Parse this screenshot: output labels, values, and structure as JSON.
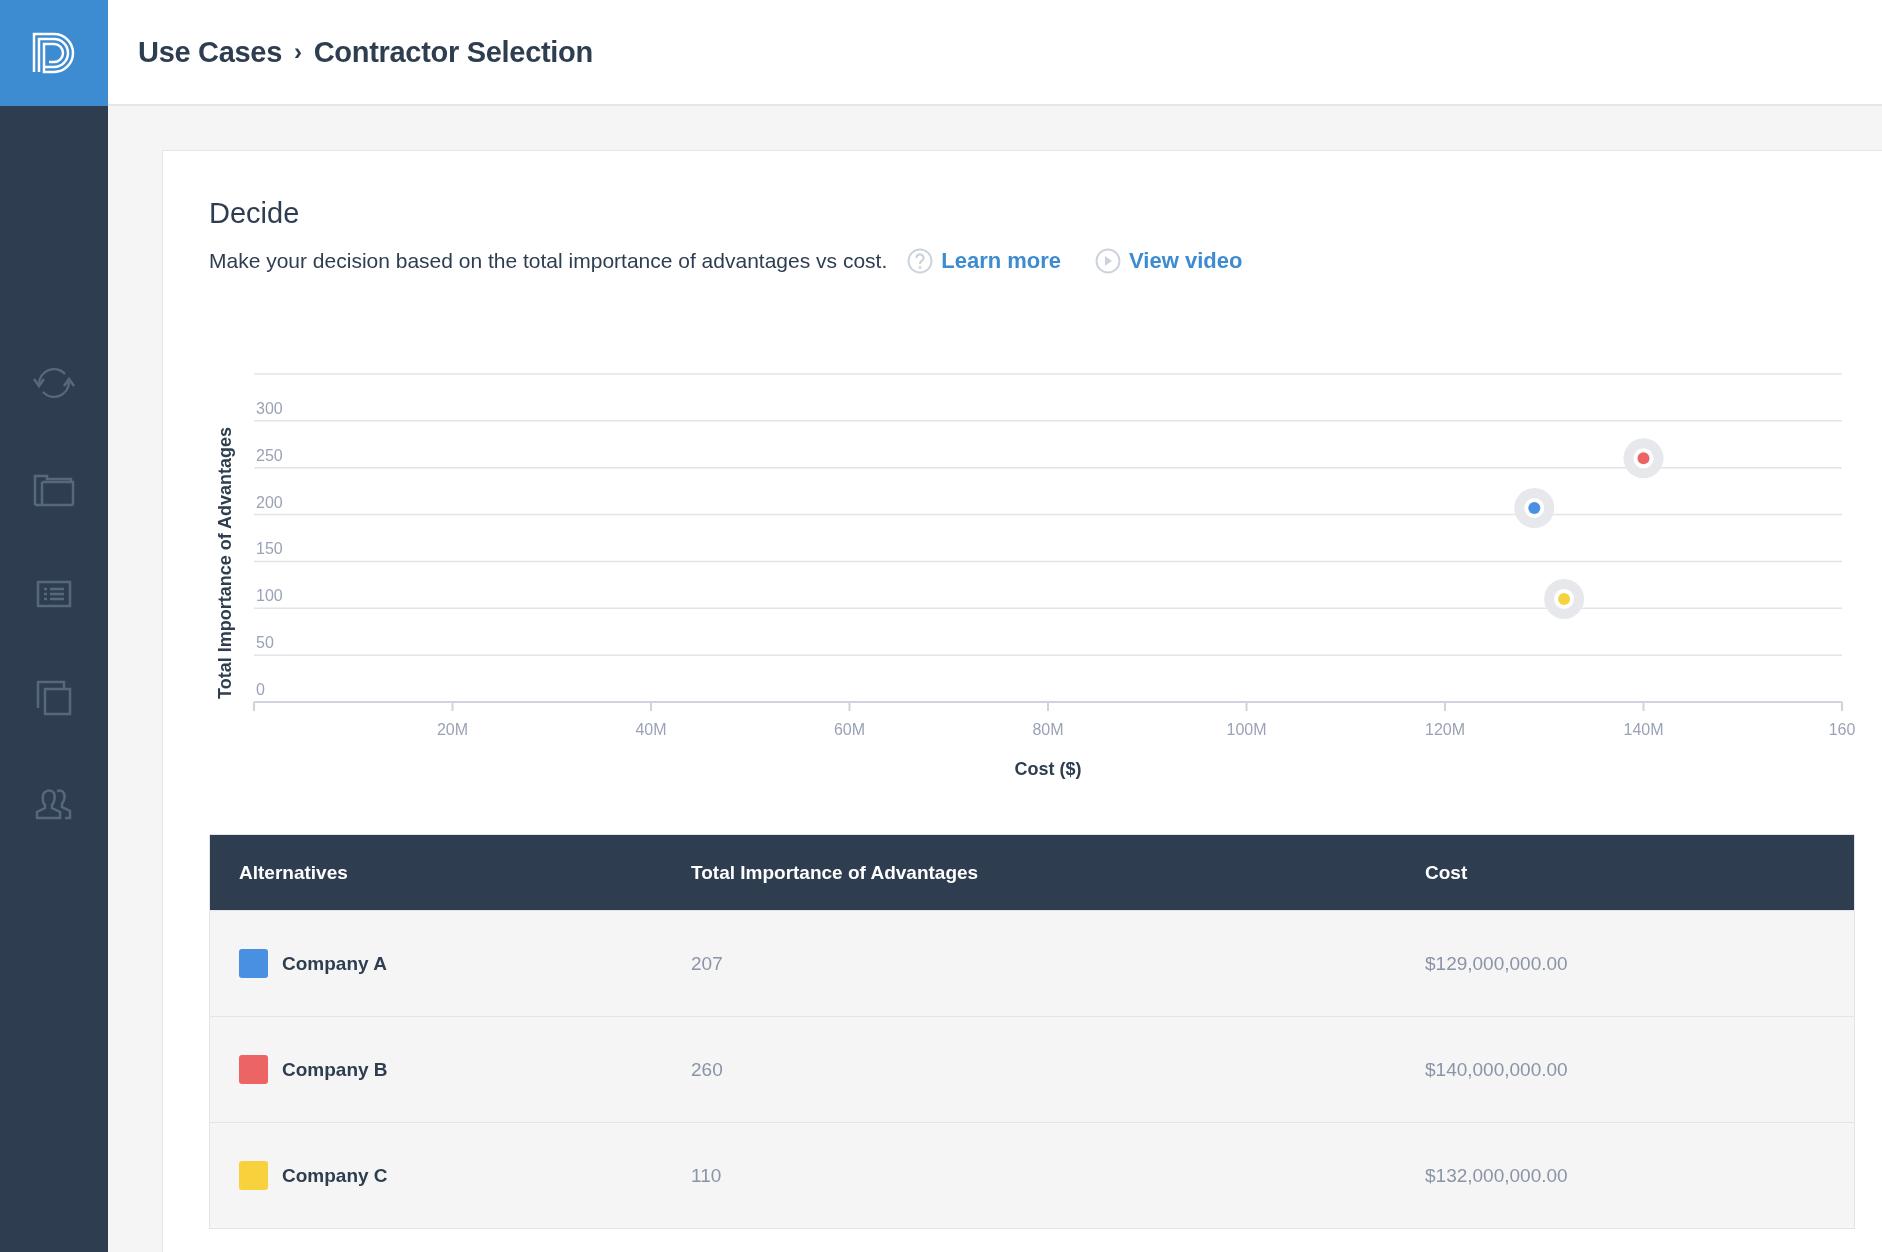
{
  "header": {
    "breadcrumb": [
      "Use Cases",
      "Contractor Selection"
    ],
    "separator": "›"
  },
  "section": {
    "title": "Decide",
    "description": "Make your decision based on the total importance of advantages vs cost.",
    "links": [
      {
        "kind": "help",
        "label": "Learn more"
      },
      {
        "kind": "video",
        "label": "View video"
      }
    ]
  },
  "chart": {
    "chart_data": {
      "type": "scatter",
      "grid": true,
      "xlabel": "Cost ($)",
      "ylabel": "Total Importance of Advantages",
      "xlim": [
        0,
        160
      ],
      "ylim": [
        0,
        350
      ],
      "xticks": [
        {
          "value": 20,
          "label": "20M"
        },
        {
          "value": 40,
          "label": "40M"
        },
        {
          "value": 60,
          "label": "60M"
        },
        {
          "value": 80,
          "label": "80M"
        },
        {
          "value": 100,
          "label": "100M"
        },
        {
          "value": 120,
          "label": "120M"
        },
        {
          "value": 140,
          "label": "140M"
        },
        {
          "value": 160,
          "label": "160"
        }
      ],
      "yticks": [
        0,
        50,
        100,
        150,
        200,
        250,
        300
      ],
      "series": [
        {
          "color": "#4a90e2",
          "x": [
            129
          ],
          "values": [
            207
          ]
        },
        {
          "color": "#ec6464",
          "x": [
            140
          ],
          "values": [
            260
          ]
        },
        {
          "color": "#f8d23c",
          "x": [
            132
          ],
          "values": [
            110
          ]
        }
      ]
    }
  },
  "table": {
    "columns": [
      "Alternatives",
      "Total Importance of Advantages",
      "Cost"
    ],
    "rows": [
      {
        "name": "Company A",
        "color": "#4a90e2",
        "importance": "207",
        "cost": "$129,000,000.00"
      },
      {
        "name": "Company B",
        "color": "#ec6464",
        "importance": "260",
        "cost": "$140,000,000.00"
      },
      {
        "name": "Company C",
        "color": "#f8d23c",
        "importance": "110",
        "cost": "$132,000,000.00"
      }
    ]
  }
}
